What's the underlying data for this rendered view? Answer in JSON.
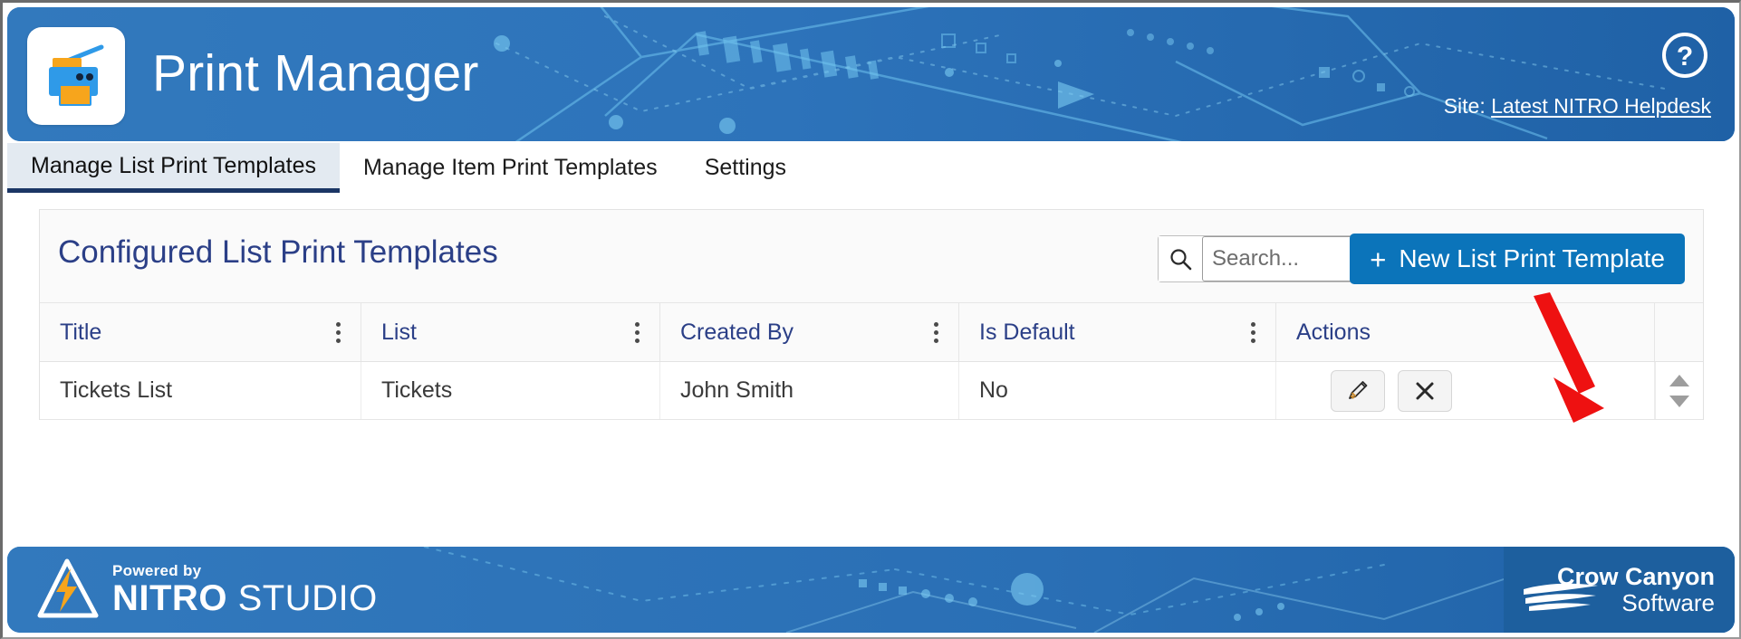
{
  "header": {
    "title": "Print Manager",
    "logo_icon": "printer-icon",
    "help_icon": "help-circle-icon",
    "site_prefix": "Site:",
    "site_name": "Latest NITRO Helpdesk",
    "bg_color": "#2f78bd"
  },
  "tabs": [
    {
      "label": "Manage List Print Templates",
      "active": true
    },
    {
      "label": "Manage Item Print Templates",
      "active": false
    },
    {
      "label": "Settings",
      "active": false
    }
  ],
  "card": {
    "title": "Configured List Print Templates",
    "search": {
      "value": "",
      "placeholder": "Search...",
      "icon": "search-icon"
    },
    "new_button": {
      "plus": "+",
      "label": "New List Print Template",
      "color": "#0b74ba"
    }
  },
  "table": {
    "columns": [
      "Title",
      "List",
      "Created By",
      "Is Default",
      "Actions"
    ],
    "rows": [
      {
        "title": "Tickets List",
        "list": "Tickets",
        "created_by": "John Smith",
        "is_default": "No",
        "actions": [
          "edit-icon",
          "delete-icon"
        ]
      }
    ],
    "scroll": {
      "up": "scroll-up-arrow",
      "down": "scroll-down-arrow"
    }
  },
  "footer": {
    "powered_by": "Powered by",
    "nitro_bold": "NITRO",
    "nitro_light": "STUDIO",
    "crow_line1": "Crow Canyon",
    "crow_line2": "Software",
    "bg_color": "#2f78bd",
    "crow_bg": "#1d5f9e"
  },
  "annotation": {
    "arrow": "red-annotation-arrow",
    "color": "#ee1111"
  }
}
